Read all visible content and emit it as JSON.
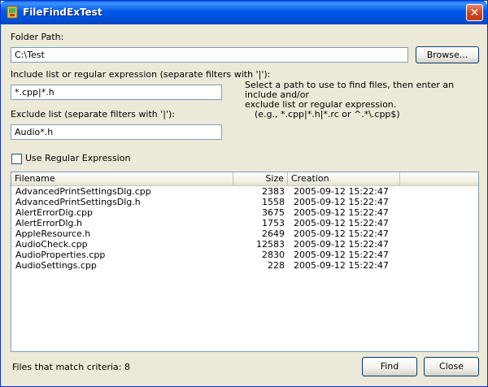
{
  "window": {
    "title": "FileFindExTest",
    "close_glyph": "✕"
  },
  "folder": {
    "label": "Folder Path:",
    "value": "C:\\Test",
    "browse_label": "Browse..."
  },
  "include": {
    "label": "Include list or regular expression (separate filters with '|'):",
    "value": "*.cpp|*.h"
  },
  "exclude": {
    "label": "Exclude list (separate filters with '|'):",
    "value": "Audio*.h"
  },
  "hint": {
    "line1": "Select a path to use to find files, then enter an include and/or",
    "line2": "exclude list or regular expression.",
    "line3": "(e.g., *.cpp|*.h|*.rc  or  ^.*\\.cpp$)"
  },
  "regex": {
    "label": "Use Regular Expression",
    "checked": false
  },
  "table": {
    "columns": [
      "Filename",
      "Size",
      "Creation"
    ],
    "rows": [
      {
        "name": "AdvancedPrintSettingsDlg.cpp",
        "size": "2383",
        "created": "2005-09-12 15:22:47"
      },
      {
        "name": "AdvancedPrintSettingsDlg.h",
        "size": "1558",
        "created": "2005-09-12 15:22:47"
      },
      {
        "name": "AlertErrorDlg.cpp",
        "size": "3675",
        "created": "2005-09-12 15:22:47"
      },
      {
        "name": "AlertErrorDlg.h",
        "size": "1753",
        "created": "2005-09-12 15:22:47"
      },
      {
        "name": "AppleResource.h",
        "size": "2649",
        "created": "2005-09-12 15:22:47"
      },
      {
        "name": "AudioCheck.cpp",
        "size": "12583",
        "created": "2005-09-12 15:22:47"
      },
      {
        "name": "AudioProperties.cpp",
        "size": "2830",
        "created": "2005-09-12 15:22:47"
      },
      {
        "name": "AudioSettings.cpp",
        "size": "228",
        "created": "2005-09-12 15:22:47"
      }
    ]
  },
  "status": {
    "label": "Files that match criteria: 8"
  },
  "buttons": {
    "find": "Find",
    "close": "Close"
  }
}
